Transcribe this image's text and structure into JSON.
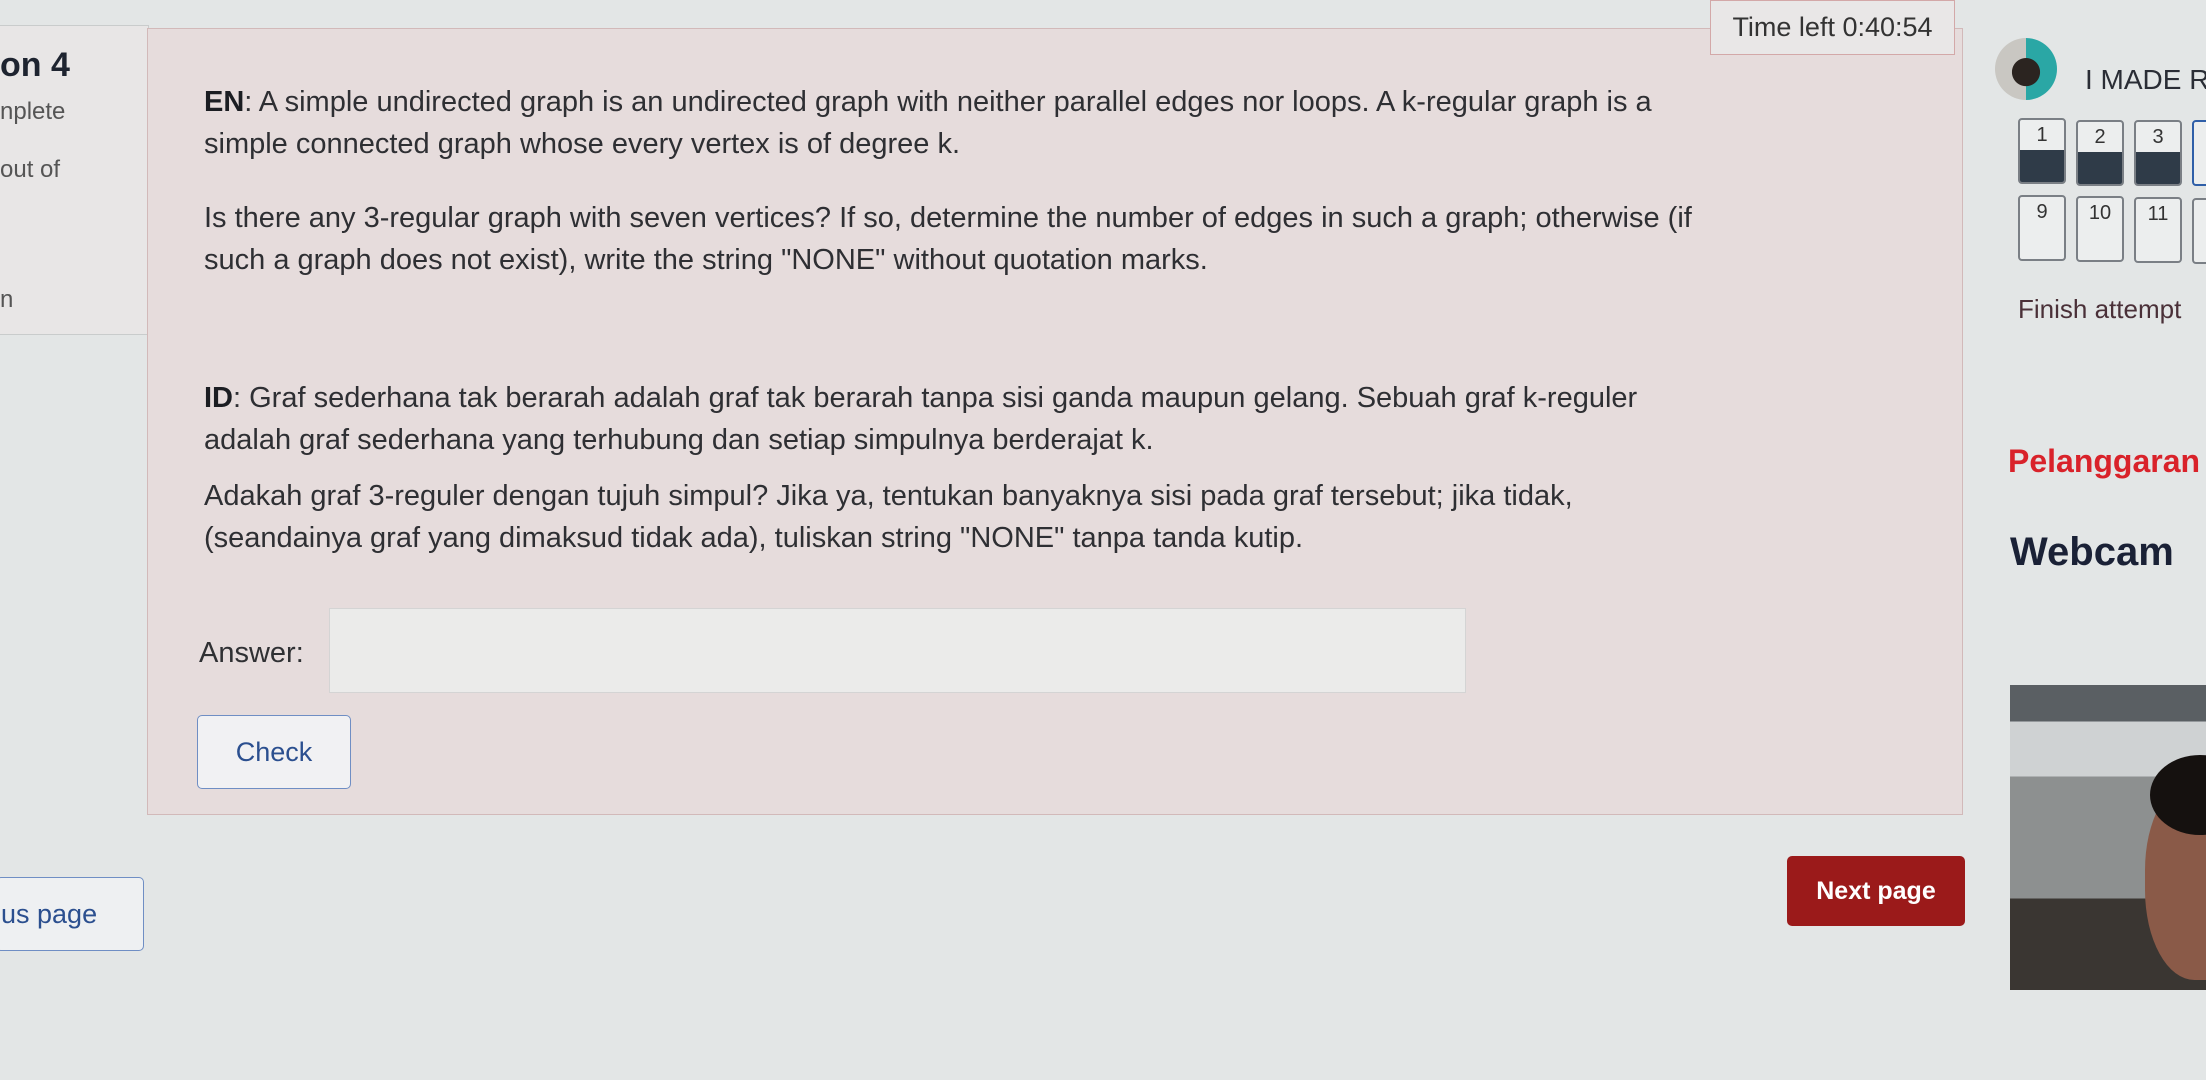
{
  "info": {
    "question_no": "on 4",
    "status": "nplete",
    "mark": "out of",
    "flag": "n"
  },
  "question": {
    "en_label": "EN",
    "en_lines": [
      ": A simple undirected graph is an undirected graph with neither parallel edges nor loops. A k-regular graph is a",
      "simple connected graph whose every vertex is of degree k."
    ],
    "en_q_lines": [
      "Is there any 3-regular graph with seven vertices? If so, determine the number of edges in such a graph; otherwise (if",
      "such a graph does not exist), write the string \"NONE\" without quotation marks."
    ],
    "id_label": "ID",
    "id_lines": [
      ": Graf sederhana tak berarah adalah graf tak berarah tanpa sisi ganda maupun gelang. Sebuah graf k-reguler",
      "adalah graf sederhana yang terhubung dan setiap simpulnya berderajat k."
    ],
    "id_q_lines": [
      "Adakah graf 3-reguler dengan tujuh simpul? Jika ya, tentukan banyaknya sisi pada graf tersebut; jika tidak,",
      "(seandainya graf yang dimaksud tidak ada), tuliskan string \"NONE\" tanpa tanda kutip."
    ],
    "answer_label": "Answer:",
    "answer_value": "",
    "check_label": "Check"
  },
  "timer": {
    "text": "Time left 0:40:54"
  },
  "user": {
    "name": "I MADE RA"
  },
  "nav": [
    {
      "n": "1",
      "answered": true
    },
    {
      "n": "2",
      "answered": true
    },
    {
      "n": "3",
      "answered": true
    },
    {
      "n": "9",
      "answered": false
    },
    {
      "n": "10",
      "answered": false
    },
    {
      "n": "11",
      "answered": false
    }
  ],
  "finish_label": "Finish attempt",
  "violation_label": "Pelanggaran",
  "webcam_title": "Webcam",
  "prev_label": "us page",
  "next_label": "Next page",
  "colors": {
    "accent_red": "#9b1a1a",
    "violation": "#d9222a",
    "link_blue": "#2b4f8f"
  }
}
